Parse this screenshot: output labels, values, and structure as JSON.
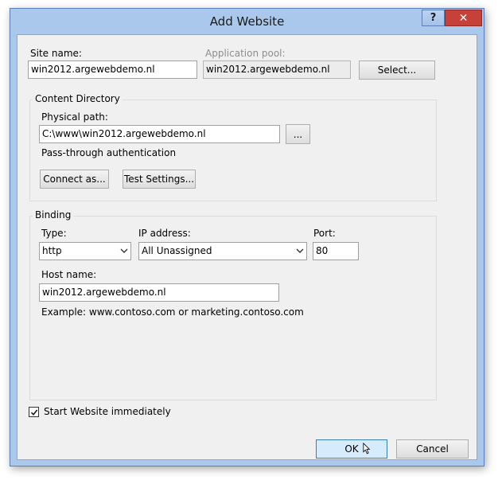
{
  "window": {
    "title": "Add Website",
    "help_glyph": "?",
    "close_glyph": "✕"
  },
  "site": {
    "site_name_label": "Site name:",
    "site_name_value": "win2012.argewebdemo.nl",
    "app_pool_label": "Application pool:",
    "app_pool_value": "win2012.argewebdemo.nl",
    "select_label": "Select..."
  },
  "content_directory": {
    "group_label": "Content Directory",
    "physical_path_label": "Physical path:",
    "physical_path_value": "C:\\www\\win2012.argewebdemo.nl",
    "browse_label": "...",
    "passthrough_label": "Pass-through authentication",
    "connect_as_label": "Connect as...",
    "test_settings_label": "Test Settings..."
  },
  "binding": {
    "group_label": "Binding",
    "type_label": "Type:",
    "type_value": "http",
    "ip_label": "IP address:",
    "ip_value": "All Unassigned",
    "port_label": "Port:",
    "port_value": "80",
    "host_label": "Host name:",
    "host_value": "win2012.argewebdemo.nl",
    "example_text": "Example: www.contoso.com or marketing.contoso.com"
  },
  "start_website": {
    "label": "Start Website immediately",
    "checked": true
  },
  "footer": {
    "ok_label": "OK",
    "cancel_label": "Cancel"
  },
  "colors": {
    "frame": "#a9c8ec",
    "close": "#c7413b",
    "client": "#f0f0f0",
    "default_button": "#d6ebfb"
  }
}
